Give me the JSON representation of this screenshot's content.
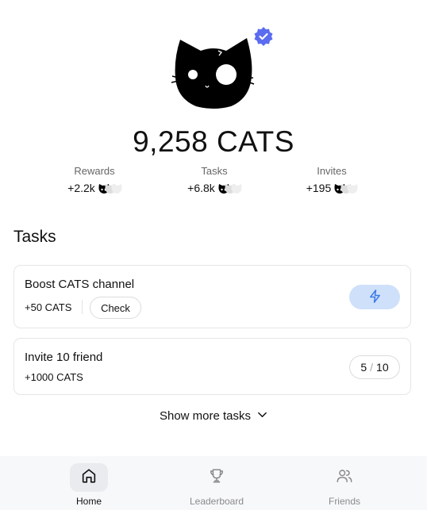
{
  "profile": {
    "avatar_icon": "black-cat-avatar",
    "verified_icon": "verified-badge-icon",
    "balance": "9,258 CATS"
  },
  "stats": [
    {
      "label": "Rewards",
      "value": "+2.2k"
    },
    {
      "label": "Tasks",
      "value": "+6.8k"
    },
    {
      "label": "Invites",
      "value": "+195"
    }
  ],
  "tasks": {
    "title": "Tasks",
    "items": [
      {
        "title": "Boost CATS channel",
        "reward": "+50 CATS",
        "action_label": "Check",
        "action_icon": "lightning-icon"
      },
      {
        "title": "Invite 10 friend",
        "reward": "+1000 CATS",
        "progress_current": "5",
        "progress_separator": "/",
        "progress_total": "10"
      }
    ],
    "show_more_label": "Show more tasks"
  },
  "nav": {
    "items": [
      {
        "label": "Home",
        "icon": "home-icon",
        "active": true
      },
      {
        "label": "Leaderboard",
        "icon": "trophy-icon",
        "active": false
      },
      {
        "label": "Friends",
        "icon": "friends-icon",
        "active": false
      }
    ]
  },
  "colors": {
    "accent_blue": "#5b6cf0",
    "boost_bg": "#cfe0fb",
    "boost_icon": "#3b7be6"
  }
}
